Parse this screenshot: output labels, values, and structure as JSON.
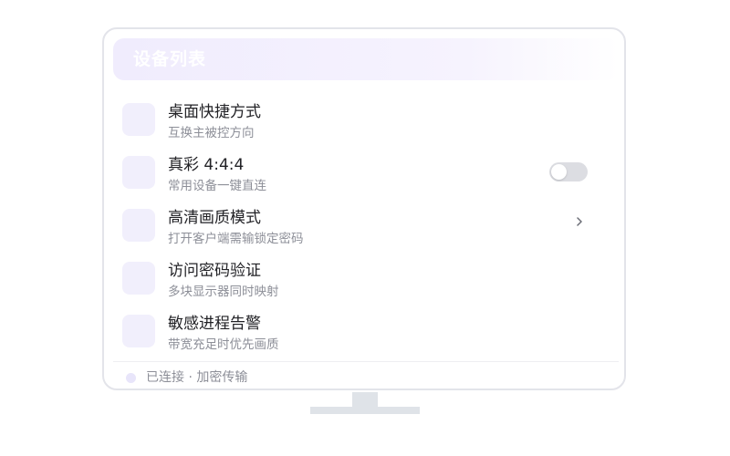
{
  "header": {
    "title": "设备列表"
  },
  "rows": [
    {
      "title": "桌面快捷方式",
      "subtitle": "互换主被控方向",
      "control": "none"
    },
    {
      "title": "真彩 4:4:4",
      "subtitle": "常用设备一键直连",
      "control": "toggle",
      "toggle_on": false
    },
    {
      "title": "高清画质模式",
      "subtitle": "打开客户端需输锁定密码",
      "control": "chevron"
    },
    {
      "title": "访问密码验证",
      "subtitle": "多块显示器同时映射",
      "control": "none"
    },
    {
      "title": "敏感进程告警",
      "subtitle": "带宽充足时优先画质",
      "control": "none"
    }
  ],
  "footer": {
    "status": "已连接 · 加密传输"
  },
  "colors": {
    "accent_light": "#f1effc",
    "toggle_off": "#dcdde2",
    "text_primary": "#222226",
    "text_secondary": "#8d8f98"
  },
  "icons": {
    "row_icon": "square-icon",
    "chevron": "chevron-right-icon",
    "status": "status-dot-icon"
  }
}
